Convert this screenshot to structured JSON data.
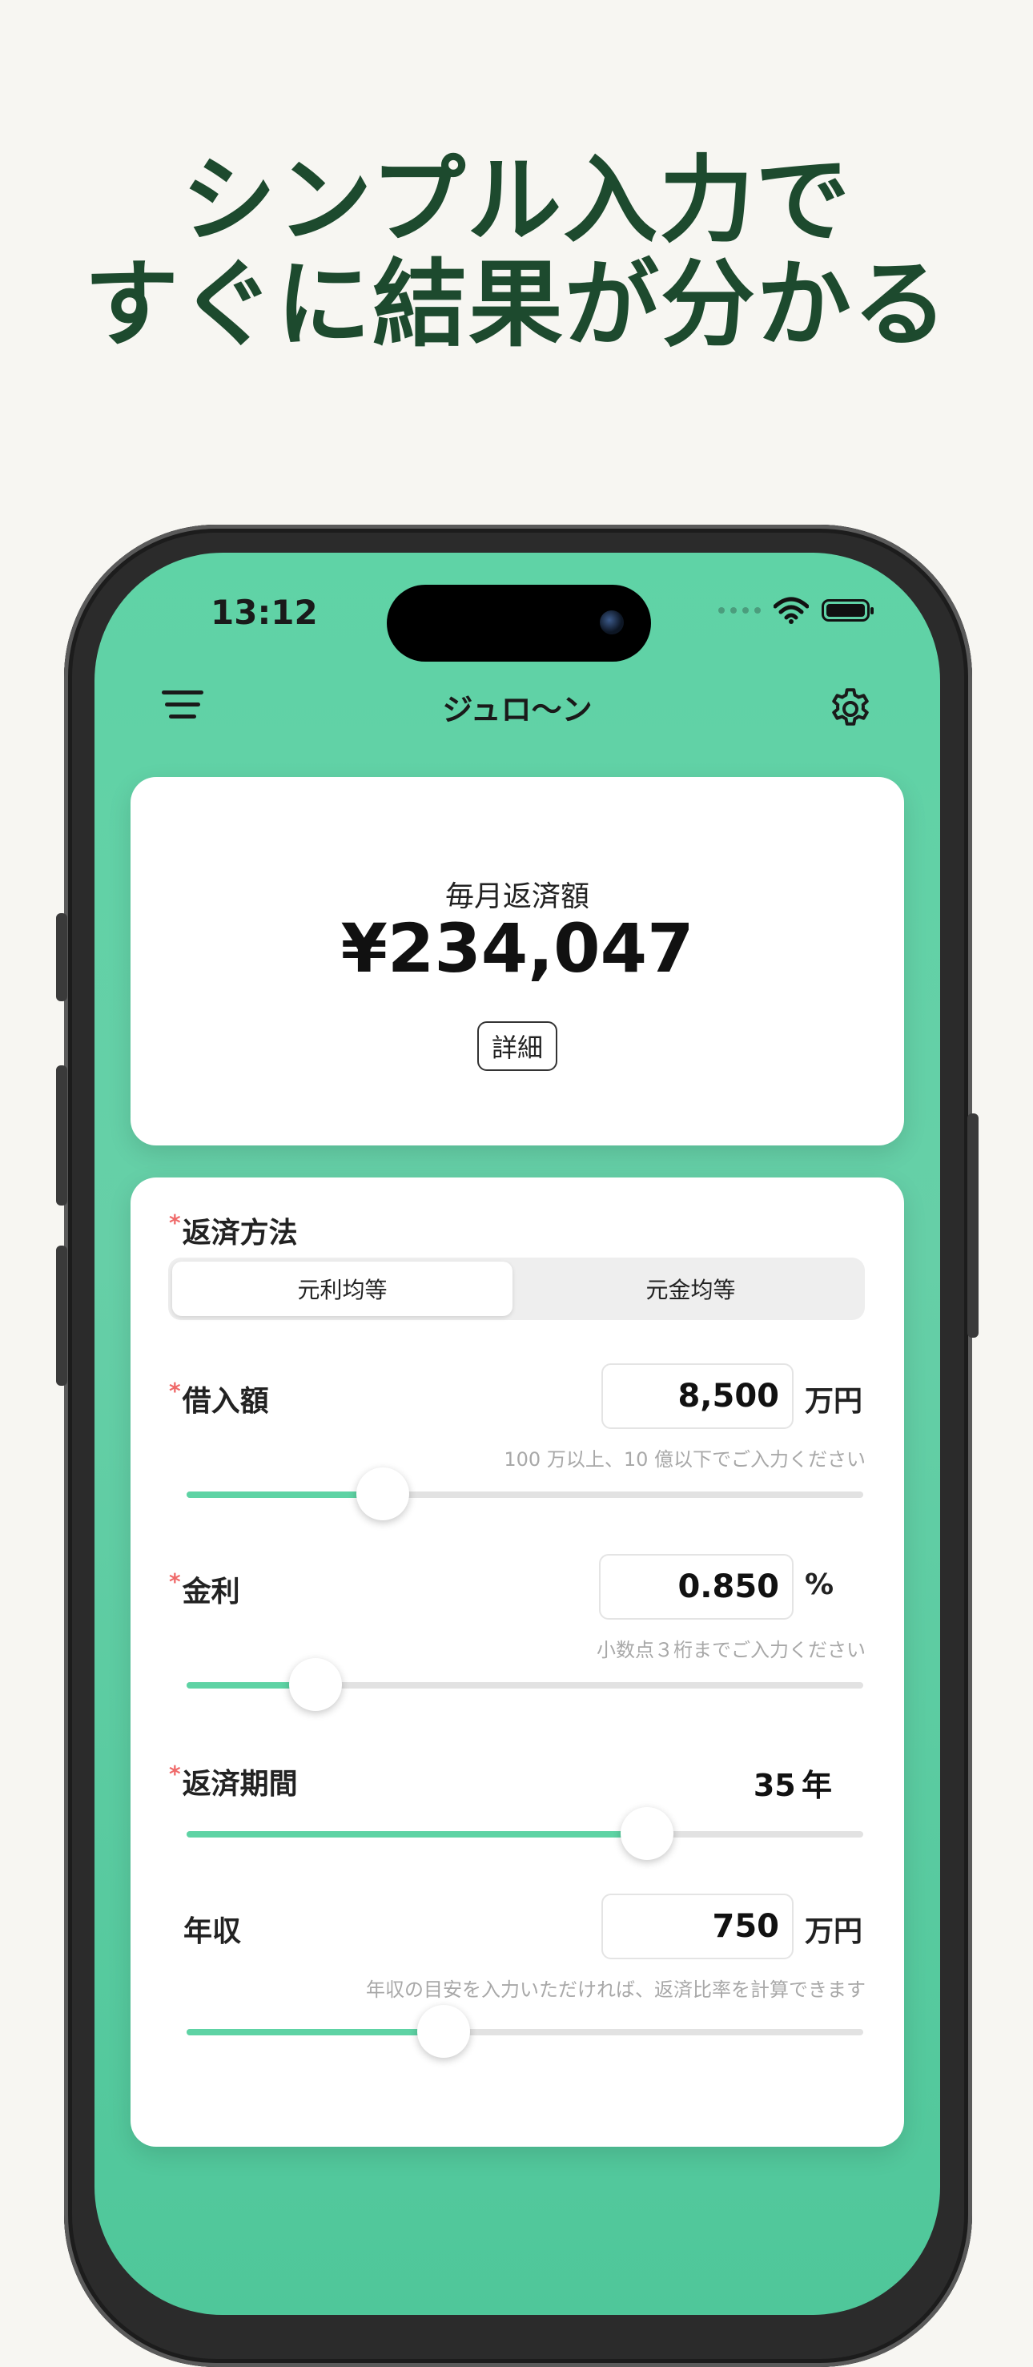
{
  "headline": {
    "line1": "シンプル入力で",
    "line2": "すぐに結果が分かる"
  },
  "status_bar": {
    "time": "13:12"
  },
  "app": {
    "title": "ジュロ〜ン"
  },
  "result": {
    "label": "毎月返済額",
    "amount": "¥234,047",
    "detail_label": "詳細"
  },
  "form": {
    "required_mark": "*",
    "method": {
      "label": "返済方法",
      "options": [
        "元利均等",
        "元金均等"
      ],
      "selected": "元利均等"
    },
    "loan": {
      "label": "借入額",
      "value": "8,500",
      "unit": "万円",
      "hint": "100 万以上、10 億以下でご入力ください",
      "slider_fraction": 0.29
    },
    "rate": {
      "label": "金利",
      "value": "0.850",
      "unit": "%",
      "hint": "小数点３桁までご入力ください",
      "slider_fraction": 0.19
    },
    "period": {
      "label": "返済期間",
      "value": "35",
      "unit": "年",
      "slider_fraction": 0.68
    },
    "income": {
      "label": "年収",
      "value": "750",
      "unit": "万円",
      "hint": "年収の目安を入力いただければ、返済比率を計算できます",
      "slider_fraction": 0.38
    }
  },
  "colors": {
    "accent": "#5ed3a4",
    "headline": "#1d4a2e",
    "required": "#ef6a6a"
  },
  "icons": {
    "menu": "filter-lines-icon",
    "settings": "gear-icon",
    "wifi": "wifi-icon",
    "battery": "battery-icon"
  }
}
